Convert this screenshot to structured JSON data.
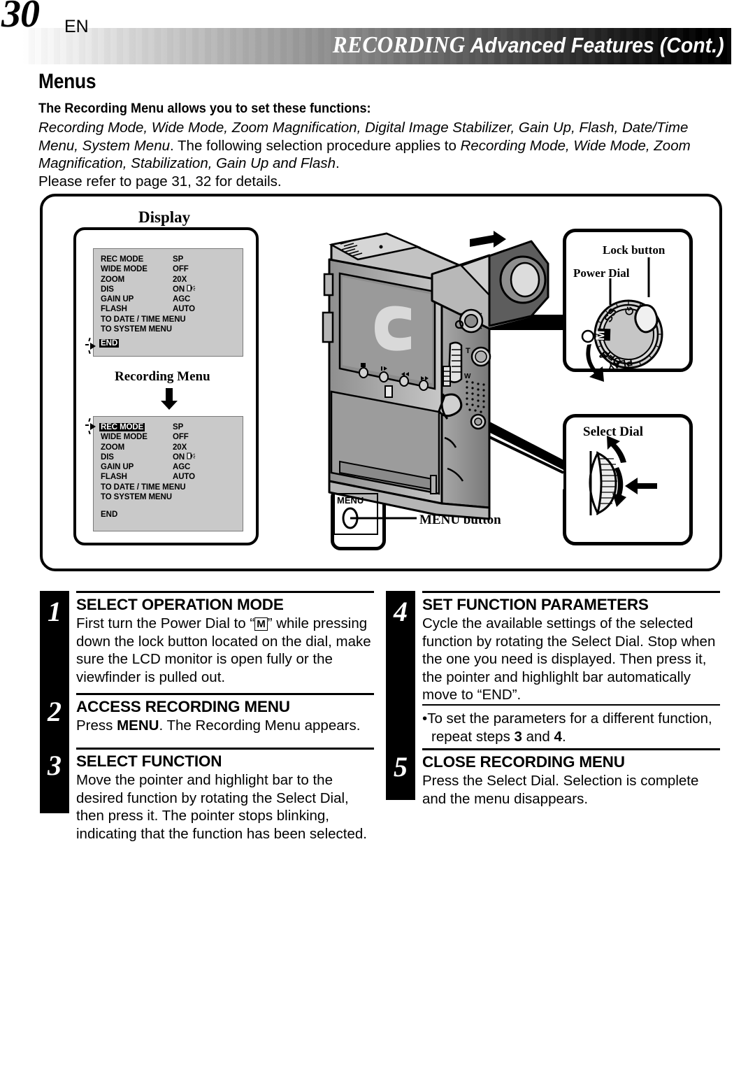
{
  "header": {
    "page_number": "30",
    "language": "EN",
    "title_lead": "RECORDING",
    "title_rest": "Advanced Features (Cont.)"
  },
  "section": {
    "heading": "Menus",
    "intro_bold": "The Recording Menu allows you to set these functions:",
    "intro_body_1_italic": "Recording Mode, Wide Mode, Zoom Magnification, Digital Image Stabilizer, Gain Up, Flash, Date/Time Menu, System Menu",
    "intro_body_2": ". The following selection procedure applies to ",
    "intro_body_3_italic": "Recording Mode, Wide Mode, Zoom Magnification, Stabilization, Gain Up and Flash",
    "intro_body_4": ".",
    "intro_body_5": "Please refer to page 31, 32 for details."
  },
  "diagram": {
    "display_label": "Display",
    "recording_menu_label": "Recording Menu",
    "lock_button_label": "Lock button",
    "power_dial_label": "Power Dial",
    "select_dial_label": "Select Dial",
    "menu_button_label": "MENU button",
    "menu_button_face": "MENU",
    "power_dial_positions": [
      "SS",
      "M",
      "A",
      "OFF",
      "PLAY"
    ],
    "power_dial_selected": "M"
  },
  "menu_screen_1": {
    "rows": [
      {
        "key": "REC MODE",
        "value": "SP",
        "highlight": false
      },
      {
        "key": "WIDE MODE",
        "value": "OFF",
        "highlight": false
      },
      {
        "key": "ZOOM",
        "value": "20X",
        "highlight": false
      },
      {
        "key": "DIS",
        "value": "ON",
        "highlight": false,
        "icon": "shake-hand-icon"
      },
      {
        "key": "GAIN UP",
        "value": "AGC",
        "highlight": false
      },
      {
        "key": "FLASH",
        "value": "AUTO",
        "highlight": false
      },
      {
        "key": "TO DATE / TIME MENU",
        "value": "",
        "highlight": false,
        "wide": true
      },
      {
        "key": "TO SYSTEM MENU",
        "value": "",
        "highlight": false,
        "wide": true
      }
    ],
    "end_label": "END",
    "end_highlighted": true,
    "pointer_at": "END",
    "pointer_blinking": true
  },
  "menu_screen_2": {
    "rows": [
      {
        "key": "REC MODE",
        "value": "SP",
        "highlight": true
      },
      {
        "key": "WIDE MODE",
        "value": "OFF",
        "highlight": false
      },
      {
        "key": "ZOOM",
        "value": "20X",
        "highlight": false
      },
      {
        "key": "DIS",
        "value": "ON",
        "highlight": false,
        "icon": "shake-hand-icon"
      },
      {
        "key": "GAIN UP",
        "value": "AGC",
        "highlight": false
      },
      {
        "key": "FLASH",
        "value": "AUTO",
        "highlight": false
      },
      {
        "key": "TO DATE / TIME MENU",
        "value": "",
        "highlight": false,
        "wide": true
      },
      {
        "key": "TO SYSTEM MENU",
        "value": "",
        "highlight": false,
        "wide": true
      }
    ],
    "end_label": "END",
    "end_highlighted": false,
    "pointer_at": "REC MODE",
    "pointer_blinking": true
  },
  "steps": [
    {
      "number": "1",
      "title": "SELECT OPERATION MODE",
      "text_a": "First turn the Power Dial to “",
      "text_badge": "M",
      "text_b": "” while pressing down the lock button located on the dial, make sure the LCD monitor is open fully or the viewfinder is pulled out."
    },
    {
      "number": "2",
      "title": "ACCESS RECORDING MENU",
      "text_a": "Press ",
      "text_bold": "MENU",
      "text_b": ". The Recording Menu appears."
    },
    {
      "number": "3",
      "title": "SELECT FUNCTION",
      "text": "Move the pointer and highlight bar to the desired function by rotating the Select Dial, then press it. The pointer stops blinking, indicating that the function has been selected."
    },
    {
      "number": "4",
      "title": "SET FUNCTION PARAMETERS",
      "text": "Cycle the available settings of the selected function by rotating the Select Dial. Stop when the one you need is displayed. Then press it, the pointer and highlighlt bar automatically move to “END”.",
      "note_a": "To set the parameters for a different function, repeat steps ",
      "note_b": "3",
      "note_c": " and ",
      "note_d": "4",
      "note_e": "."
    },
    {
      "number": "5",
      "title": "CLOSE RECORDING MENU",
      "text": "Press the Select Dial. Selection is complete and the menu disappears."
    }
  ],
  "colors": {
    "screen_background": "#c9c9c9",
    "ink": "#000000",
    "page": "#ffffff"
  }
}
